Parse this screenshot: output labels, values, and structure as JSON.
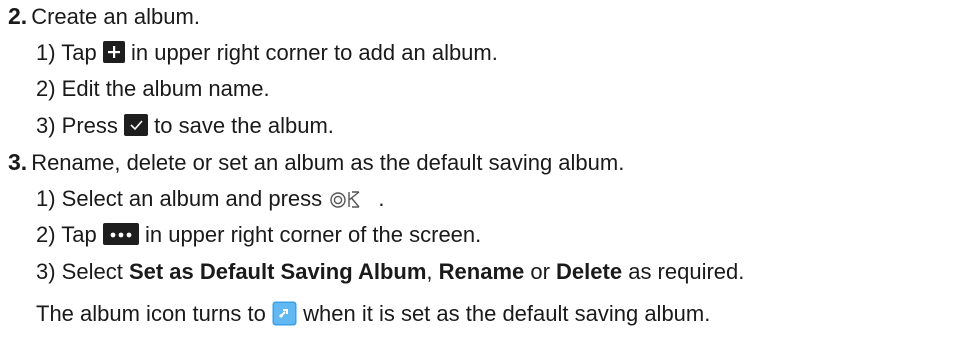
{
  "step2": {
    "number": "2.",
    "title": "Create an album.",
    "sub1": {
      "prefix": "1) Tap ",
      "icon": "plus-icon",
      "suffix": " in upper right corner to add an album."
    },
    "sub2": {
      "text": "2) Edit the album name."
    },
    "sub3": {
      "prefix": "3) Press ",
      "icon": "check-icon",
      "suffix": " to save the album."
    }
  },
  "step3": {
    "number": "3.",
    "title": "Rename, delete or set an album as the default saving album.",
    "sub1": {
      "prefix": "1) Select an album and press ",
      "icon": "ok-button-icon",
      "suffix": " ."
    },
    "sub2": {
      "prefix": "2) Tap ",
      "icon": "more-icon",
      "suffix": " in upper right corner of the screen."
    },
    "sub3": {
      "prefix": "3) Select ",
      "bold1": "Set as Default Saving Album",
      "sep1": ", ",
      "bold2": "Rename",
      "sep2": " or ",
      "bold3": "Delete",
      "suffix": " as required."
    },
    "note": {
      "prefix": "The album icon turns to ",
      "icon": "default-album-icon",
      "suffix": " when it is set as the default saving album."
    }
  },
  "colors": {
    "text": "#1a1a1a",
    "icon_dark": "#1e1e1e",
    "album_blue": "#3aa0e8"
  }
}
